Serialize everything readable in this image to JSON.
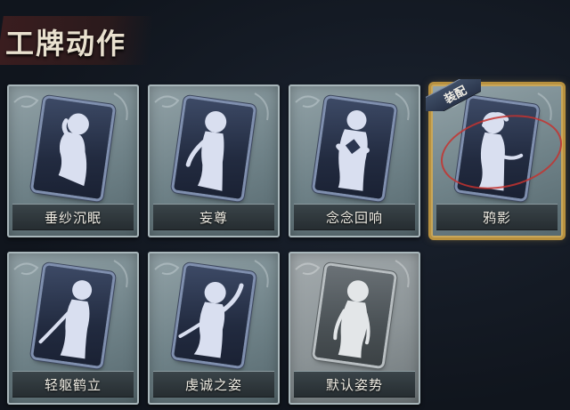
{
  "header": {
    "title": "工牌动作"
  },
  "cards": [
    {
      "label": "垂纱沉眠",
      "pose": "sleep"
    },
    {
      "label": "妄尊",
      "pose": "proud"
    },
    {
      "label": "念念回响",
      "pose": "hug"
    },
    {
      "label": "鸦影",
      "pose": "crow",
      "equipped": true,
      "badge": "装配"
    },
    {
      "label": "轻躯鹤立",
      "pose": "crane"
    },
    {
      "label": "虔诚之姿",
      "pose": "pious"
    },
    {
      "label": "默认姿势",
      "pose": "default",
      "default": true
    }
  ],
  "colors": {
    "equipped_border": "#b8913f",
    "equip_circle": "#c4332f",
    "card_frame": "#7f8fae",
    "figure": "#d9dff0"
  }
}
